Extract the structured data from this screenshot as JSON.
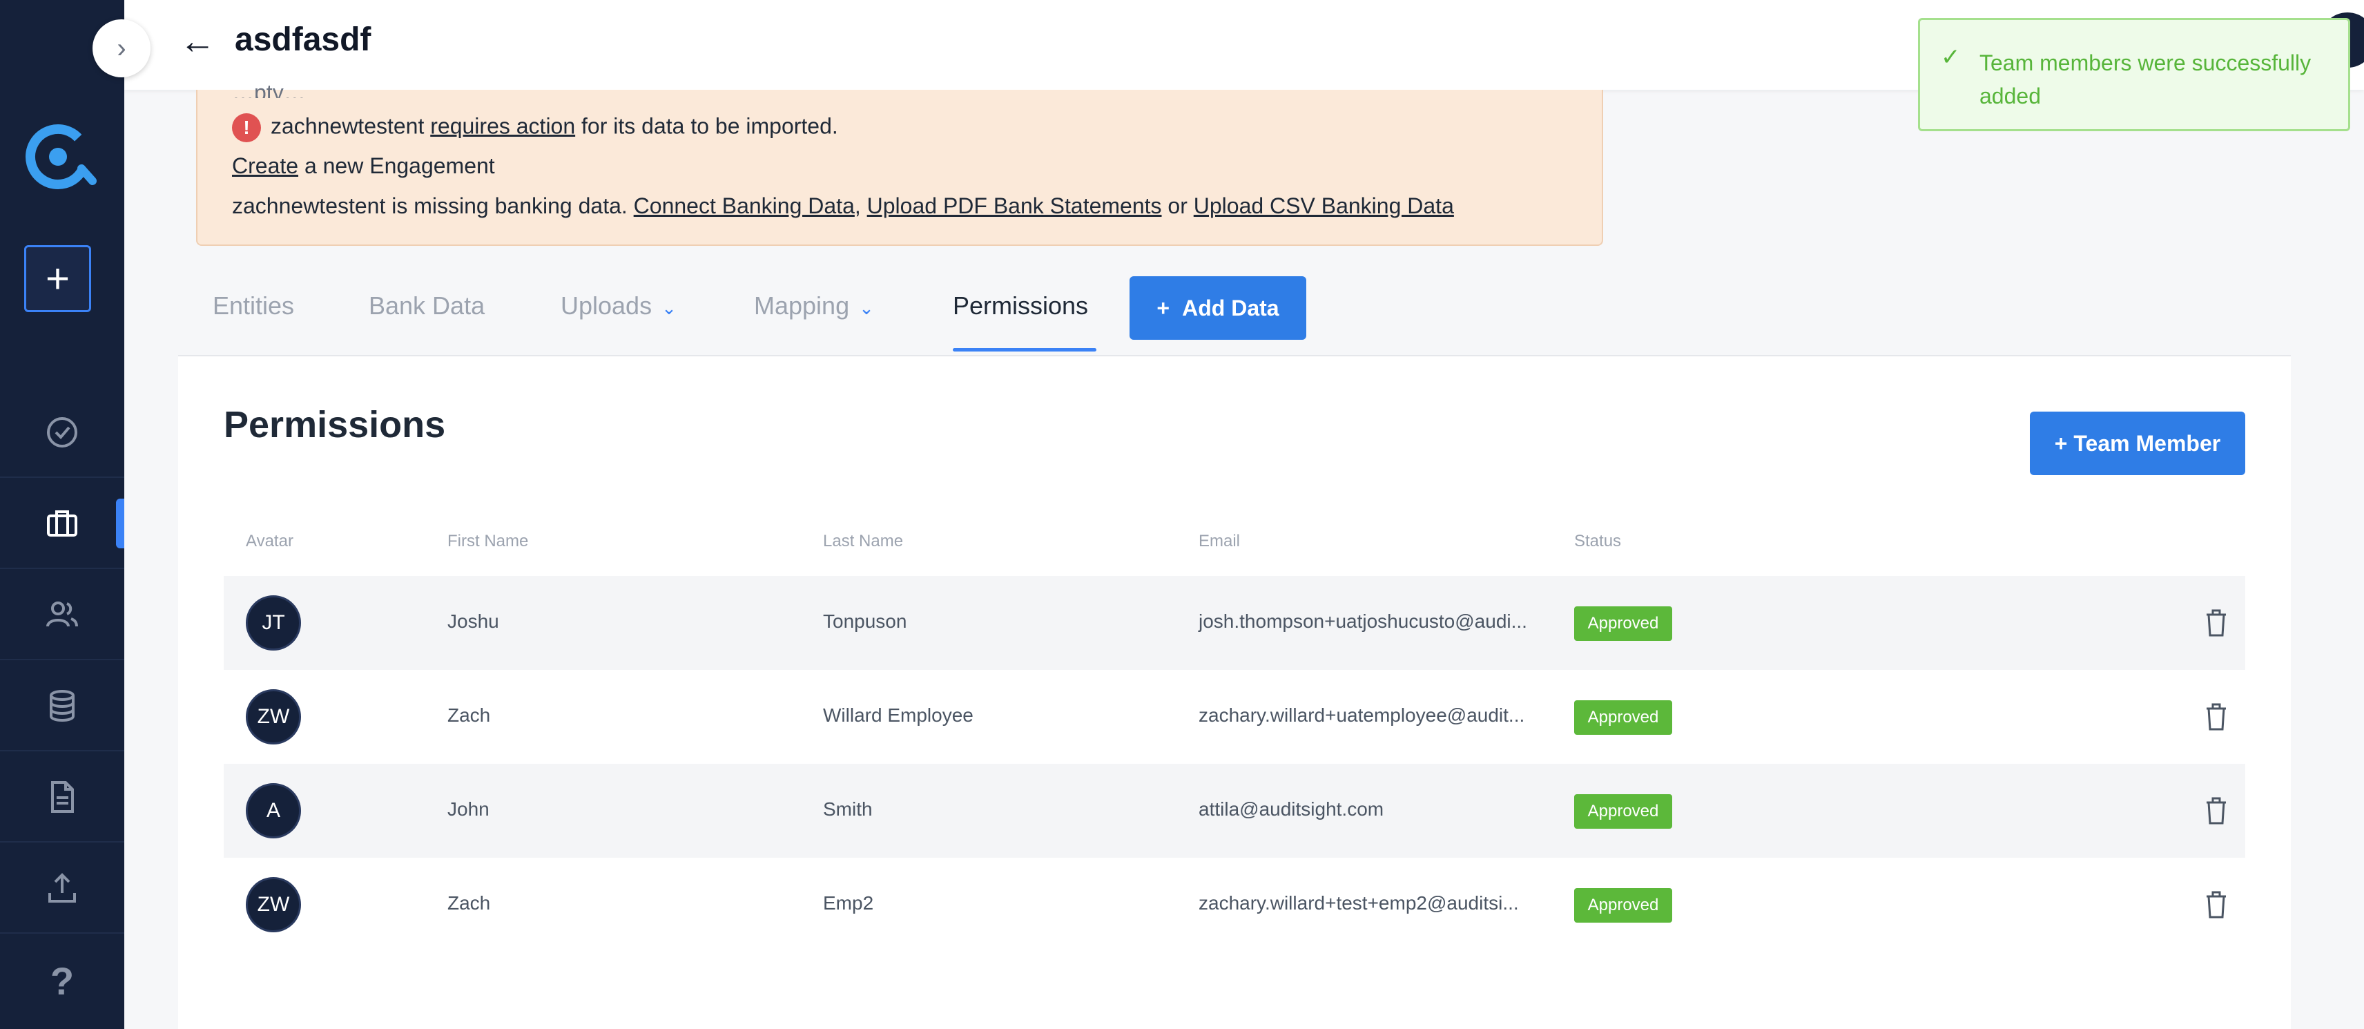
{
  "header": {
    "title": "asdfasdf"
  },
  "alert": {
    "cut_line": "…pty…",
    "line1_entity": "zachnewtestent",
    "line1_link": "requires action",
    "line1_rest": "for its data to be imported.",
    "line2_link": "Create",
    "line2_rest": "a new Engagement",
    "line3_prefix": "zachnewtestent is missing banking data.",
    "link_connect": "Connect Banking Data",
    "comma": ",",
    "link_pdf": "Upload PDF Bank Statements",
    "or": "or",
    "link_csv": "Upload CSV Banking Data"
  },
  "tabs": {
    "entities": "Entities",
    "bank_data": "Bank Data",
    "uploads": "Uploads",
    "mapping": "Mapping",
    "permissions": "Permissions",
    "add_data": "Add Data",
    "plus": "+"
  },
  "permissions": {
    "title": "Permissions",
    "team_member_button": "+ Team Member",
    "columns": {
      "avatar": "Avatar",
      "first_name": "First Name",
      "last_name": "Last Name",
      "email": "Email",
      "status": "Status"
    },
    "rows": [
      {
        "initials": "JT",
        "first": "Joshu",
        "last": "Tonpuson",
        "email": "josh.thompson+uatjoshucusto@audi...",
        "status": "Approved"
      },
      {
        "initials": "ZW",
        "first": "Zach",
        "last": "Willard Employee",
        "email": "zachary.willard+uatemployee@audit...",
        "status": "Approved"
      },
      {
        "initials": "A",
        "first": "John",
        "last": "Smith",
        "email": "attila@auditsight.com",
        "status": "Approved"
      },
      {
        "initials": "ZW",
        "first": "Zach",
        "last": "Emp2",
        "email": "zachary.willard+test+emp2@auditsi...",
        "status": "Approved"
      }
    ]
  },
  "toast": {
    "message": "Team members were successfully added"
  },
  "icons": {
    "collapse": "›",
    "back": "←",
    "add": "+",
    "help": "?",
    "check": "✓",
    "error": "!",
    "chevron": "⌄"
  },
  "colors": {
    "sidebar_bg": "#15213a",
    "accent": "#2f7de6",
    "approved": "#5cb83a",
    "alert_bg": "#fbe9d9",
    "toast_bg": "#eefbe9"
  }
}
